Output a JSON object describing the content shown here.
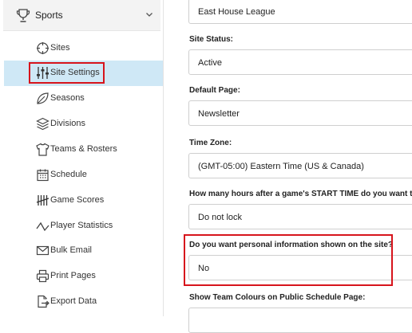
{
  "sidebar": {
    "section_label": "Sports",
    "items": [
      {
        "label": "Sites",
        "icon": "crosshair-icon"
      },
      {
        "label": "Site Settings",
        "icon": "sliders-icon"
      },
      {
        "label": "Seasons",
        "icon": "leaf-icon"
      },
      {
        "label": "Divisions",
        "icon": "layers-icon"
      },
      {
        "label": "Teams & Rosters",
        "icon": "jersey-icon"
      },
      {
        "label": "Schedule",
        "icon": "calendar-icon"
      },
      {
        "label": "Game Scores",
        "icon": "tally-icon"
      },
      {
        "label": "Player Statistics",
        "icon": "line-chart-icon"
      },
      {
        "label": "Bulk Email",
        "icon": "envelope-icon"
      },
      {
        "label": "Print Pages",
        "icon": "printer-icon"
      },
      {
        "label": "Export Data",
        "icon": "export-icon"
      }
    ]
  },
  "form": {
    "site_name_value": "East House League",
    "site_status_label": "Site Status:",
    "site_status_value": "Active",
    "default_page_label": "Default Page:",
    "default_page_value": "Newsletter",
    "time_zone_label": "Time Zone:",
    "time_zone_value": "(GMT-05:00) Eastern Time (US & Canada)",
    "lock_hours_label": "How many hours after a game's START TIME do you want the",
    "lock_hours_value": "Do not lock",
    "personal_info_label": "Do you want personal information shown on the site?",
    "personal_info_value": "No",
    "team_colours_label": "Show Team Colours on Public Schedule Page:"
  },
  "colors": {
    "active_item_bg": "#cfe8f6",
    "highlight_border": "#d7141c"
  }
}
